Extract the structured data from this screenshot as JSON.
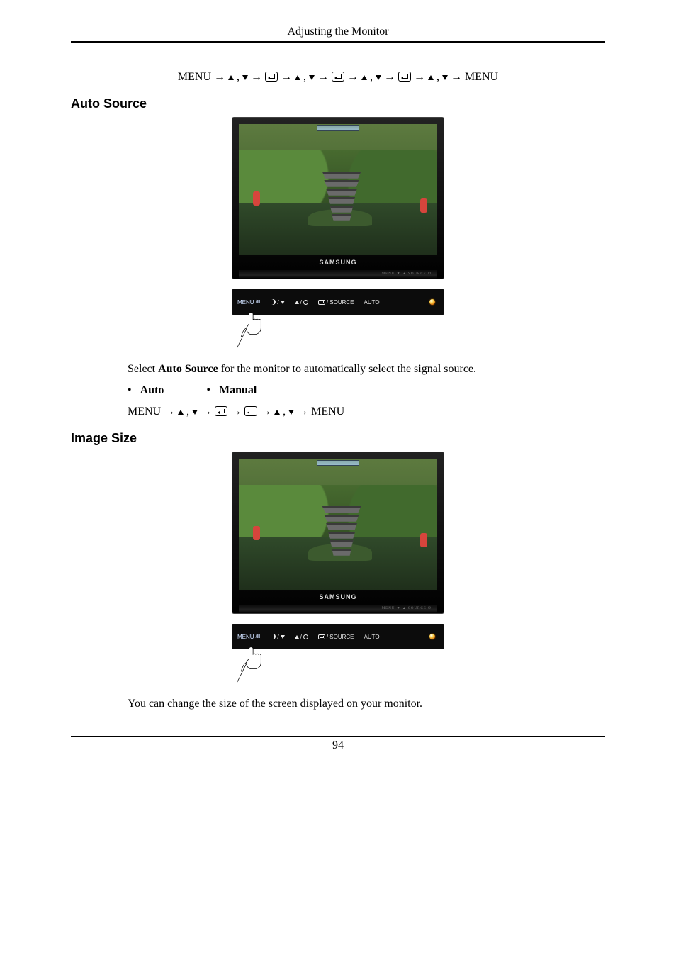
{
  "header": {
    "title": "Adjusting the Monitor"
  },
  "sequences": {
    "seq1_prefix": "MENU → ",
    "seq1_mid_a": " ,  ",
    "seq1_arrow": " → ",
    "seq1_suffix": " → MENU",
    "seq2_prefix": "MENU → ",
    "seq2_suffix": " → MENU"
  },
  "sections": {
    "auto_source": {
      "heading": "Auto Source",
      "desc_pre": "Select ",
      "desc_bold": "Auto Source",
      "desc_post": " for the monitor to automatically select the signal source.",
      "options": [
        "Auto",
        "Manual"
      ]
    },
    "image_size": {
      "heading": "Image Size",
      "desc": "You can change the size of the screen displayed on your monitor."
    }
  },
  "monitor": {
    "brand": "SAMSUNG",
    "base_tiny": "MENU   ▼   ▲   SOURCE   ⏻"
  },
  "button_strip": {
    "menu": "MENU",
    "source": "/ SOURCE",
    "auto": "AUTO"
  },
  "footer": {
    "page": "94"
  }
}
